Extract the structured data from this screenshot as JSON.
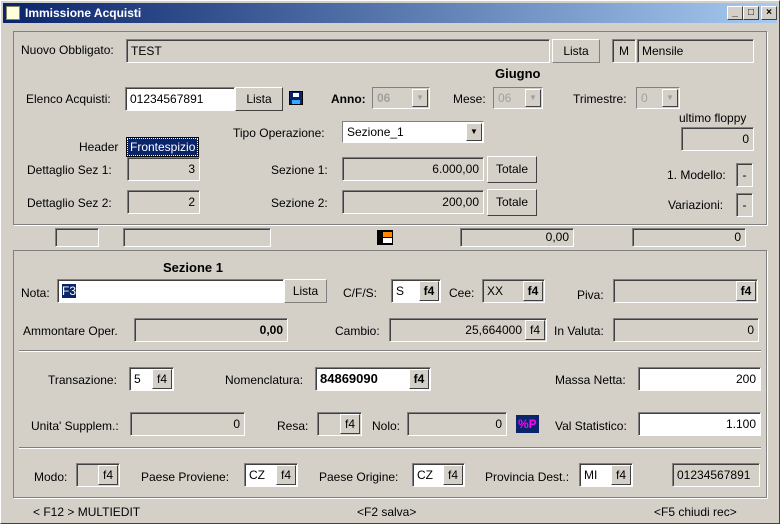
{
  "window": {
    "title": "Immissione  Acquisti",
    "min": "_",
    "max": "□",
    "close": "×"
  },
  "top": {
    "nuovo_label": "Nuovo Obbligato:",
    "nuovo_value": "TEST",
    "lista1": "Lista",
    "m_code": "M",
    "m_desc": "Mensile",
    "month": "Giugno",
    "elenco_label": "Elenco Acquisti:",
    "elenco_value": "01234567891",
    "lista2": "Lista",
    "anno_label": "Anno:",
    "anno_value": "06",
    "mese_label": "Mese:",
    "mese_value": "06",
    "trimestre_label": "Trimestre:",
    "trimestre_value": "0",
    "ultimo_label": "ultimo floppy",
    "ultimo_value": "0",
    "header_label": "Header",
    "header_value": "Frontespizio",
    "tipo_label": "Tipo Operazione:",
    "tipo_value": "Sezione_1",
    "det1_label": "Dettaglio Sez 1:",
    "det1_value": "3",
    "det2_label": "Dettaglio Sez 2:",
    "det2_value": "2",
    "sez1_label": "Sezione 1:",
    "sez1_value": "6.000,00",
    "sez2_label": "Sezione 2:",
    "sez2_value": "200,00",
    "totale1": "Totale",
    "totale2": "Totale",
    "modello_label": "1. Modello:",
    "modello_value": "-",
    "variazioni_label": "Variazioni:",
    "variazioni_value": "-"
  },
  "status": {
    "amount": "0,00",
    "count": "0"
  },
  "sezione": {
    "title": "Sezione 1",
    "nota_label": "Nota:",
    "nota_value": "F3",
    "nota_lista": "Lista",
    "cfs_label": "C/F/S:",
    "cfs_value": "S",
    "cee_label": "Cee:",
    "cee_value": "XX",
    "piva_label": "Piva:",
    "f4": "f4",
    "ammontare_label": "Ammontare Oper.",
    "ammontare_value": "0,00",
    "cambio_label": "Cambio:",
    "cambio_value": "25,664000",
    "valuta_label": "In Valuta:",
    "valuta_value": "0",
    "transazione_label": "Transazione:",
    "transazione_value": "5",
    "nomenclatura_label": "Nomenclatura:",
    "nomenclatura_value": "84869090",
    "massa_label": "Massa Netta:",
    "massa_value": "200",
    "unita_label": "Unita' Supplem.:",
    "unita_value": "0",
    "resa_label": "Resa:",
    "nolo_label": "Nolo:",
    "nolo_value": "0",
    "pct_label": "%P",
    "valstat_label": "Val Statistico:",
    "valstat_value": "1.100",
    "modo_label": "Modo:",
    "paese_prov_label": "Paese Proviene:",
    "paese_prov_value": "CZ",
    "paese_orig_label": "Paese Origine:",
    "paese_orig_value": "CZ",
    "provincia_label": "Provincia Dest.:",
    "provincia_value": "MI",
    "piva_display": "01234567891"
  },
  "footer": {
    "left": "< F12 > MULTIEDIT",
    "mid": "<F2 salva>",
    "right": "<F5 chiudi rec>"
  }
}
